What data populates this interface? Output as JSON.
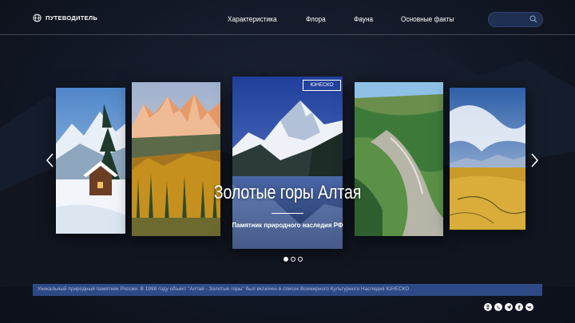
{
  "header": {
    "logo_label": "ПУТЕВОДИТЕЛЬ",
    "nav": [
      {
        "label": "Характеристика"
      },
      {
        "label": "Флора"
      },
      {
        "label": "Фауна"
      },
      {
        "label": "Основные факты"
      }
    ],
    "search": {
      "placeholder": "",
      "value": ""
    }
  },
  "slider": {
    "badge": "ЮНЕСКО",
    "title": "Золотые горы Алтая",
    "subtitle": "Памятник природного наследия РФ",
    "cards": [
      {
        "name": "winter-cabin"
      },
      {
        "name": "autumn-peaks"
      },
      {
        "name": "lake-peak"
      },
      {
        "name": "green-valley"
      },
      {
        "name": "golden-steppe"
      }
    ],
    "dots": [
      {
        "active": true
      },
      {
        "active": false
      },
      {
        "active": false
      }
    ]
  },
  "ticker": {
    "text": "Уникальный природный памятник России. В 1998 году объект \"Алтай - Золотые горы\" был включен в список Всемирного Культурного Наследия ЮНЕСКО"
  },
  "social": [
    "odnoklassniki-icon",
    "viber-icon",
    "telegram-icon",
    "facebook-icon",
    "vk-icon"
  ],
  "colors": {
    "accent": "#2e4a86",
    "search_bg": "#1f2f52",
    "background": "#121826"
  }
}
